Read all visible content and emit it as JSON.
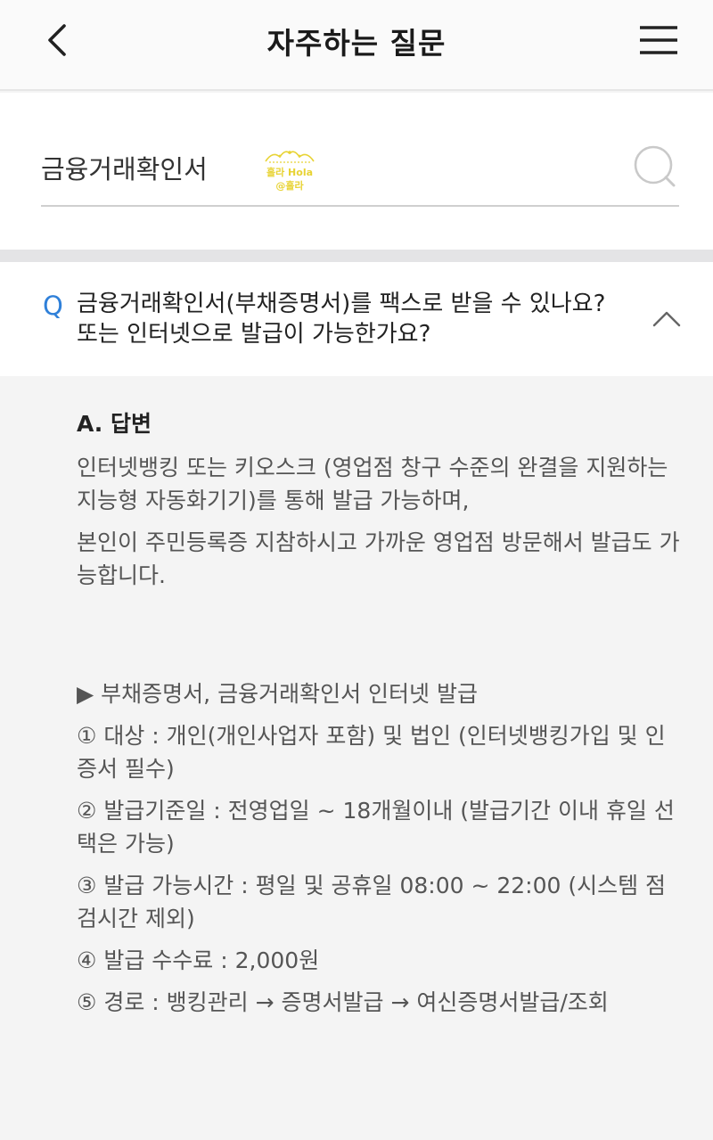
{
  "header": {
    "title": "자주하는 질문",
    "back_icon": "chevron-left-icon",
    "menu_icon": "hamburger-menu-icon"
  },
  "search": {
    "value": "금융거래확인서",
    "icon": "search-icon",
    "watermark_line1": "홀라 Hola",
    "watermark_line2": "@홀라"
  },
  "faq": {
    "q_mark": "Q",
    "question": "금융거래확인서(부채증명서)를 팩스로 받을 수 있나요? 또는 인터넷으로 발급이 가능한가요?",
    "toggle_icon": "chevron-up-icon",
    "answer_heading": "A. 답변",
    "paragraphs": [
      "인터넷뱅킹 또는 키오스크 (영업점 창구 수준의 완결을 지원하는 지능형 자동화기기)를 통해 발급 가능하며,",
      "본인이 주민등록증 지참하시고 가까운 영업점 방문해서 발급도 가능합니다."
    ],
    "section_title": "▶ 부채증명서, 금융거래확인서 인터넷 발급",
    "items": [
      "① 대상 : 개인(개인사업자 포함) 및 법인 (인터넷뱅킹가입 및 인증서 필수)",
      "② 발급기준일 : 전영업일 ~ 18개월이내 (발급기간 이내 휴일 선택은 가능)",
      "③ 발급 가능시간 : 평일 및 공휴일 08:00 ~ 22:00 (시스템 점검시간 제외)",
      "④ 발급 수수료 : 2,000원",
      "⑤ 경로 : 뱅킹관리 → 증명서발급 → 여신증명서발급/조회"
    ]
  },
  "colors": {
    "accent": "#2f80d9",
    "header_bg": "#fafafa",
    "answer_bg": "#f4f4f4",
    "watermark": "#e8d334"
  }
}
